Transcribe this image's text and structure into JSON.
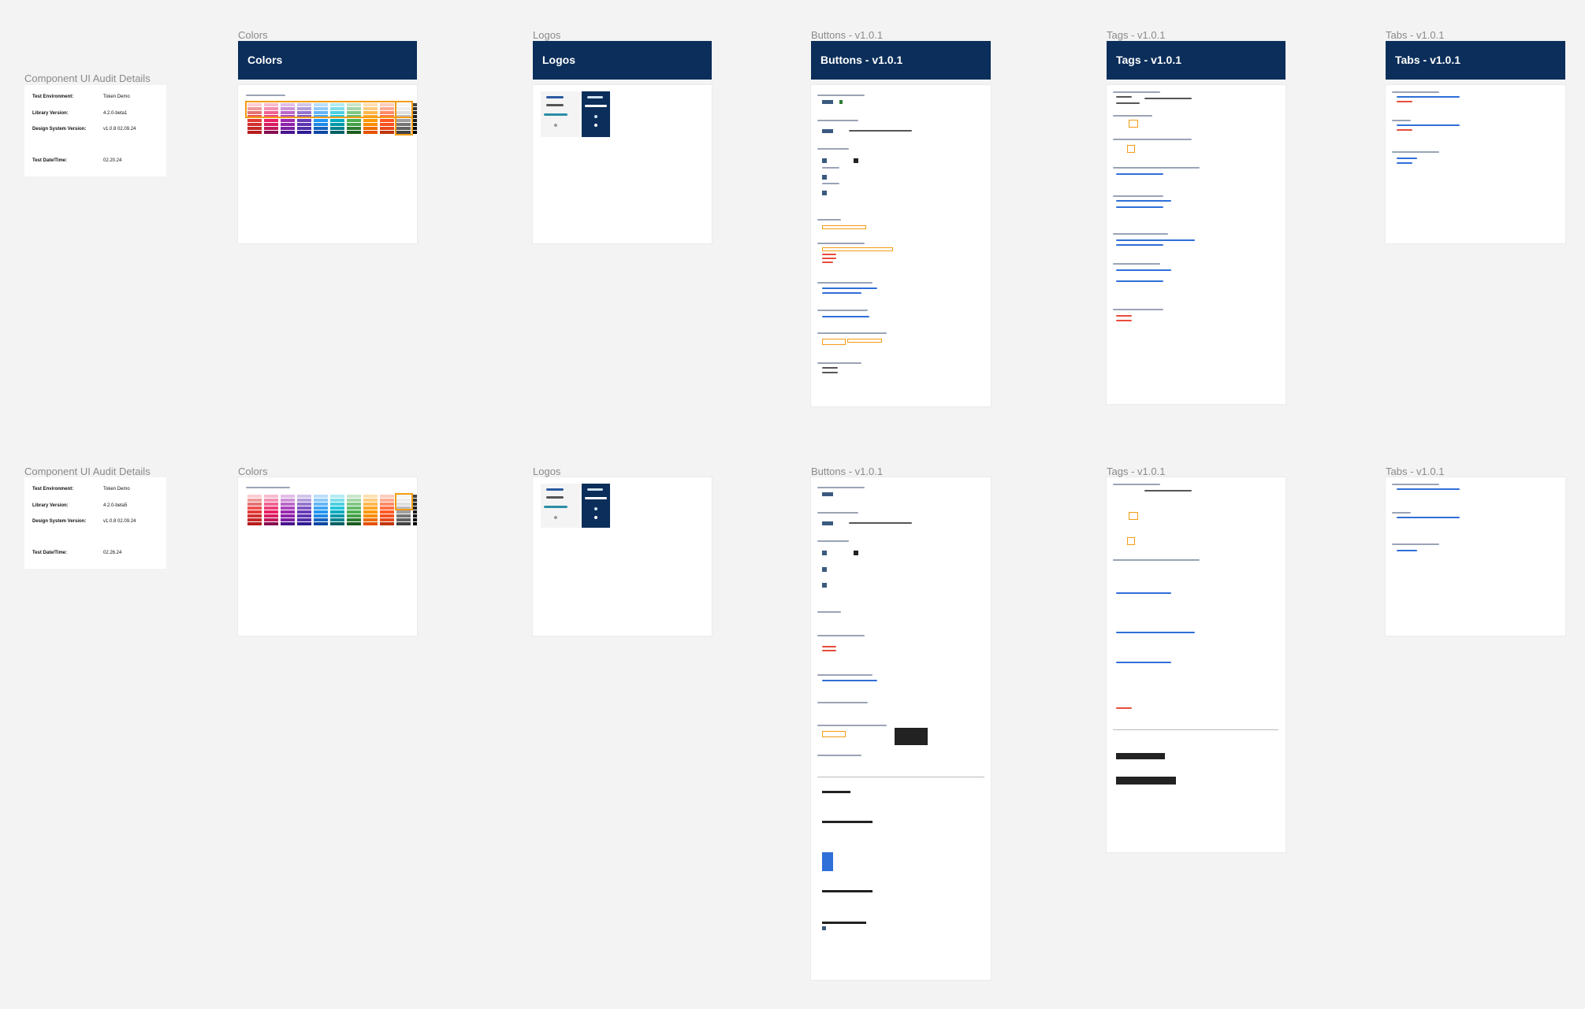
{
  "frames_top": {
    "audit_title": "Component UI Audit Details",
    "colors_title": "Colors",
    "logos_title": "Logos",
    "buttons_title": "Buttons - v1.0.1",
    "tags_title": "Tags - v1.0.1",
    "tabs_title": "Tabs - v1.0.1"
  },
  "banners": {
    "colors": "Colors",
    "logos": "Logos",
    "buttons": "Buttons - v1.0.1",
    "tags": "Tags - v1.0.1",
    "tabs": "Tabs - v1.0.1"
  },
  "audit_top": {
    "env_label": "Test Environment:",
    "env_value": "Token Demo",
    "lib_label": "Library Version:",
    "lib_value": "4.2.0-beta1",
    "ds_label": "Design System Version:",
    "ds_value": "v1.0.8 02.09.24",
    "date_label": "Test Date/Time:",
    "date_value": "02.20.24"
  },
  "frames_bottom": {
    "audit_title": "Component UI Audit Details",
    "colors_title": "Colors",
    "logos_title": "Logos",
    "buttons_title": "Buttons - v1.0.1",
    "tags_title": "Tags - v1.0.1",
    "tabs_title": "Tabs - v1.0.1"
  },
  "audit_bottom": {
    "env_label": "Test Environment:",
    "env_value": "Token Demo",
    "lib_label": "Library Version:",
    "lib_value": "4.2.0-beta5",
    "ds_label": "Design System Version:",
    "ds_value": "v1.0.8 02.09.24",
    "date_label": "Test Date/Time:",
    "date_value": "02.26.24"
  },
  "colors": {
    "banner_bg": "#0b2e5a",
    "canvas_bg": "#f3f3f3",
    "highlight": "#f39c12",
    "palette": [
      "#d32f2f",
      "#e91e63",
      "#9c27b0",
      "#5e35b1",
      "#1e88e5",
      "#00838f",
      "#2e7d32",
      "#ef6c00",
      "#e64a19",
      "#616161",
      "#212121"
    ]
  }
}
